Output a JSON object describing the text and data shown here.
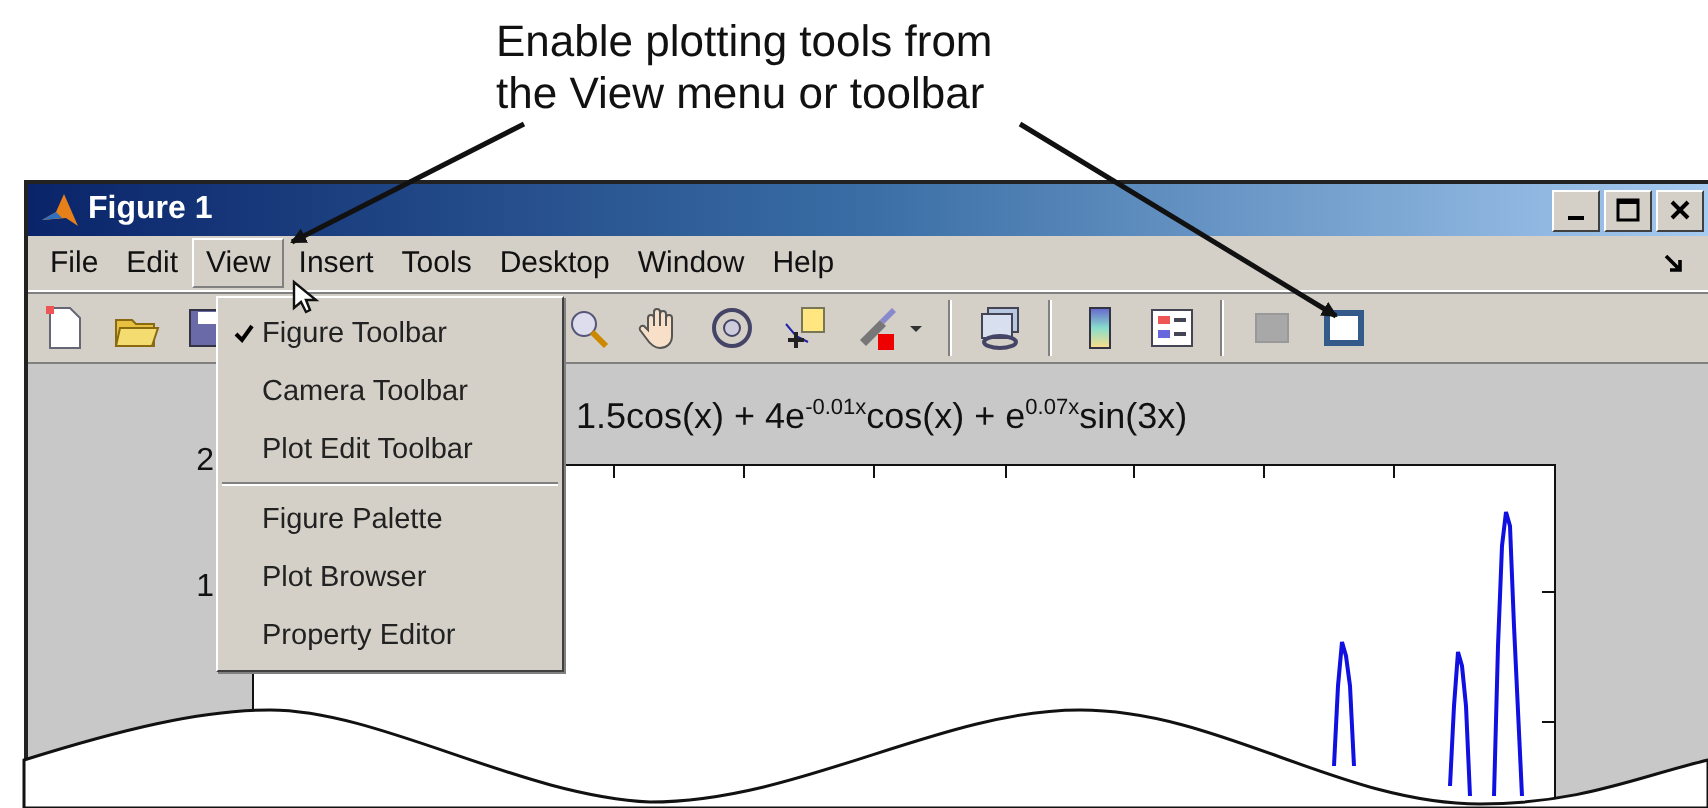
{
  "callout": {
    "lines": [
      "Enable plotting tools from",
      "the View menu or toolbar"
    ]
  },
  "window": {
    "title": "Figure 1"
  },
  "menu": [
    {
      "label": "File",
      "selected": false
    },
    {
      "label": "Edit",
      "selected": false
    },
    {
      "label": "View",
      "selected": true
    },
    {
      "label": "Insert",
      "selected": false
    },
    {
      "label": "Tools",
      "selected": false
    },
    {
      "label": "Desktop",
      "selected": false
    },
    {
      "label": "Window",
      "selected": false
    },
    {
      "label": "Help",
      "selected": false
    }
  ],
  "toolbar": [
    {
      "kind": "new"
    },
    {
      "kind": "open"
    },
    {
      "kind": "save"
    },
    {
      "kind": "zoom"
    },
    {
      "kind": "pan"
    },
    {
      "kind": "rotate"
    },
    {
      "kind": "datacursor"
    },
    {
      "kind": "brush"
    },
    {
      "kind": "caret"
    },
    {
      "kind": "separator"
    },
    {
      "kind": "link"
    },
    {
      "kind": "separator"
    },
    {
      "kind": "colorbar"
    },
    {
      "kind": "legend"
    },
    {
      "kind": "separator"
    },
    {
      "kind": "hidetools"
    },
    {
      "kind": "showtools"
    }
  ],
  "view_menu": [
    {
      "items": [
        {
          "label": "Figure Toolbar",
          "checked": true
        },
        {
          "label": "Camera Toolbar",
          "checked": false
        },
        {
          "label": "Plot Edit Toolbar",
          "checked": false
        }
      ]
    },
    {
      "items": [
        {
          "label": "Figure Palette",
          "checked": false
        },
        {
          "label": "Plot Browser",
          "checked": false
        },
        {
          "label": "Property Editor",
          "checked": false
        }
      ]
    }
  ],
  "plot": {
    "title": "1.5cos(x) + 4e$^{-0.01x}$cos(x) + e$^{0.07x}$sin(3x)",
    "y_tick_labels": [
      "2",
      "1"
    ]
  }
}
